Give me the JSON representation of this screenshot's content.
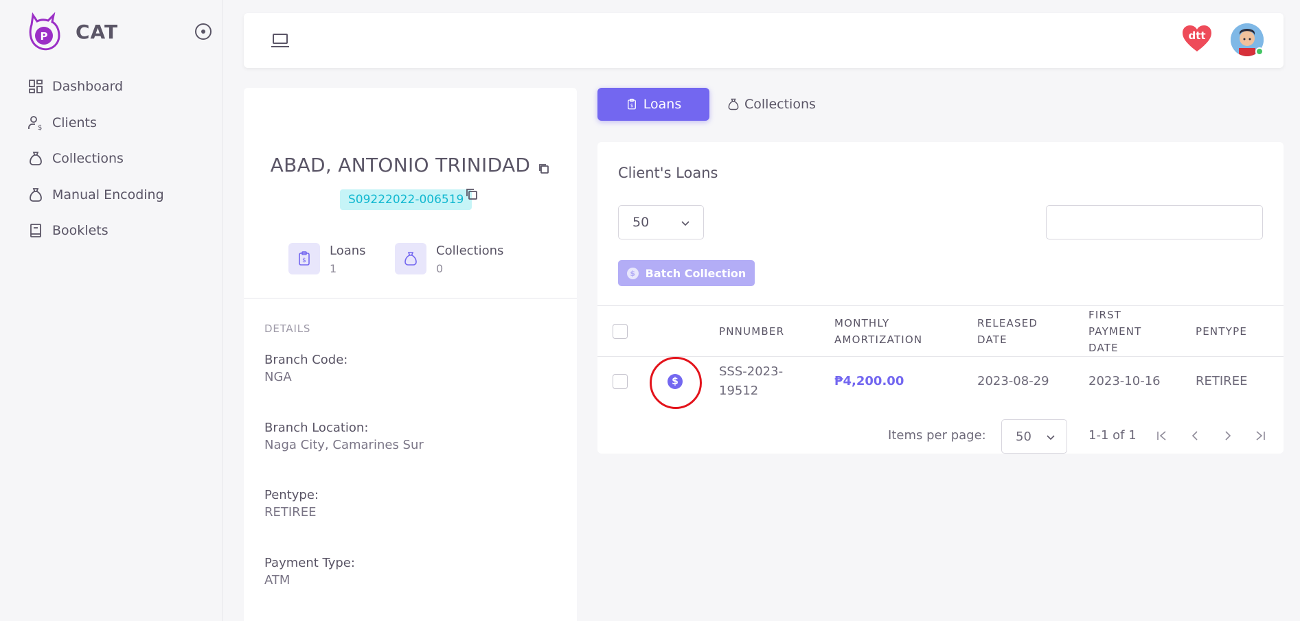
{
  "app": {
    "name": "CAT"
  },
  "sidebar": {
    "items": [
      {
        "label": "Dashboard",
        "icon": "dashboard-icon"
      },
      {
        "label": "Clients",
        "icon": "clients-icon"
      },
      {
        "label": "Collections",
        "icon": "collections-bag-icon"
      },
      {
        "label": "Manual Encoding",
        "icon": "manual-encoding-bag-icon"
      },
      {
        "label": "Booklets",
        "icon": "booklet-icon"
      }
    ]
  },
  "header": {
    "brand_logo_text": "dtt"
  },
  "client": {
    "name": "ABAD, ANTONIO TRINIDAD",
    "id": "S09222022-006519",
    "stats": [
      {
        "label": "Loans",
        "value": "1"
      },
      {
        "label": "Collections",
        "value": "0"
      }
    ],
    "details_heading": "DETAILS",
    "details": [
      {
        "label": "Branch Code:",
        "value": "NGA"
      },
      {
        "label": "Branch Location:",
        "value": "Naga City, Camarines Sur"
      },
      {
        "label": "Pentype:",
        "value": "RETIREE"
      },
      {
        "label": "Payment Type:",
        "value": "ATM"
      }
    ]
  },
  "tabs": {
    "loans": "Loans",
    "collections": "Collections"
  },
  "loans_card": {
    "title": "Client's Loans",
    "page_size": "50",
    "search": {
      "value": "",
      "placeholder": ""
    },
    "batch_button": "Batch Collection",
    "columns": {
      "pnnumber": "PNNUMBER",
      "monthly_1": "MONTHLY",
      "monthly_2": "AMORTIZATION",
      "released_1": "RELEASED",
      "released_2": "DATE",
      "first_1": "FIRST",
      "first_2": "PAYMENT",
      "first_3": "DATE",
      "pentype": "PENTYPE"
    },
    "rows": [
      {
        "pn_1": "SSS-2023-",
        "pn_2": "19512",
        "amount": "₱4,200.00",
        "released": "2023-08-29",
        "first_payment": "2023-10-16",
        "pentype": "RETIREE"
      }
    ],
    "footer": {
      "items_per_page_label": "Items per page:",
      "items_per_page": "50",
      "range": "1-1 of 1"
    }
  },
  "colors": {
    "primary": "#7367f0",
    "highlight_ring": "#e3131b",
    "id_badge_bg": "#c6f4f7"
  }
}
